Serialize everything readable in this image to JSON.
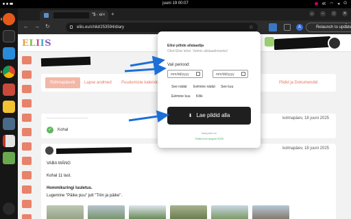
{
  "system": {
    "clock": "juuni 19  00:07",
    "tray": {
      "keyboard_layout": "et"
    }
  },
  "browser": {
    "tab_title": "\"$ - ei",
    "url": "eliis.eu/child/253594/diary",
    "relaunch_label": "Relaunch to update",
    "profile_initial": "A"
  },
  "page": {
    "logo": [
      "E",
      "L",
      "I",
      "I",
      "S"
    ],
    "tabs": [
      {
        "label": "Rühmapäevik",
        "active": true
      },
      {
        "label": "Lapse andmed",
        "active": false
      },
      {
        "label": "Puudumiste kalender",
        "active": false
      },
      {
        "label": "Pildid ja Dokumendid",
        "active": false
      }
    ],
    "entry1": {
      "date": "kolmapäev, 18 juuni 2025",
      "status": "Kohal"
    },
    "entry2": {
      "date": "kolmapäev, 18 juuni 2025",
      "line1": "VABA MÄNG",
      "line2": "Kohal 11 last.",
      "line3": "Hommikuringi luuletus.",
      "line4": "Lugemine \"Päike puu\" jutt \"Triin ja päike\"."
    }
  },
  "popup": {
    "title": "Eliisi piltide allalaadija",
    "subtitle": "Oled Eliisi lehel. Valmis allalaadimiseks!",
    "period_label": "Vali periood:",
    "date_from_placeholder": "mm/dd/yyyy",
    "date_to_placeholder": "mm/dd/yyyy",
    "quick_buttons": [
      "See nädal",
      "Eelmine nädal",
      "See kuu",
      "Eelmine kuu",
      "Kõik"
    ],
    "download_button": "Lae pildid alla",
    "footer_line1": "lastepiltid.ee",
    "footer_line2": "Tööta kuni august 2025"
  },
  "colors": {
    "accent": "#e6765e",
    "active_tab_bg": "#f3b7a7",
    "success": "#5cb85c",
    "annotation_arrow": "#1c6fd6",
    "footer_green": "#3aa655"
  }
}
